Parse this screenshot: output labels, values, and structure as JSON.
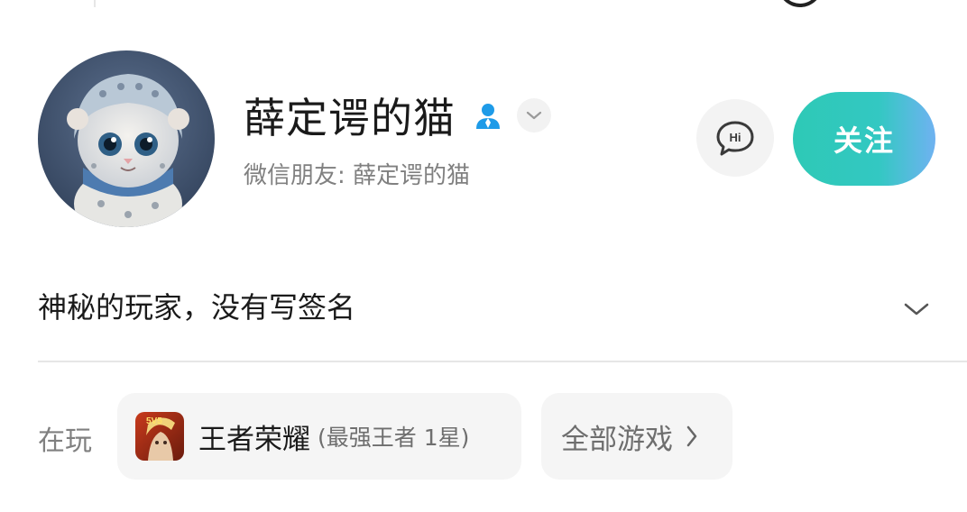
{
  "profile": {
    "name": "薛定谔的猫",
    "wechat_friend": "微信朋友: 薛定谔的猫",
    "signature": "神秘的玩家，没有写签名",
    "avatar": "snow-leopard-kitten-avatar"
  },
  "actions": {
    "hi_label": "Hi",
    "follow_label": "关注"
  },
  "playing": {
    "label": "在玩",
    "game_name": "王者荣耀",
    "game_rank": "(最强王者 1星)",
    "game_icon_badge": "5V5",
    "all_games_label": "全部游戏"
  },
  "colors": {
    "follow_gradient_start": "#2ec9b6",
    "follow_gradient_end": "#6fb2f1",
    "verified_person_icon": "#1e9be8"
  },
  "icons": [
    "person-verified-icon",
    "chevron-down-icon",
    "hi-chat-icon",
    "chevron-right-icon"
  ]
}
